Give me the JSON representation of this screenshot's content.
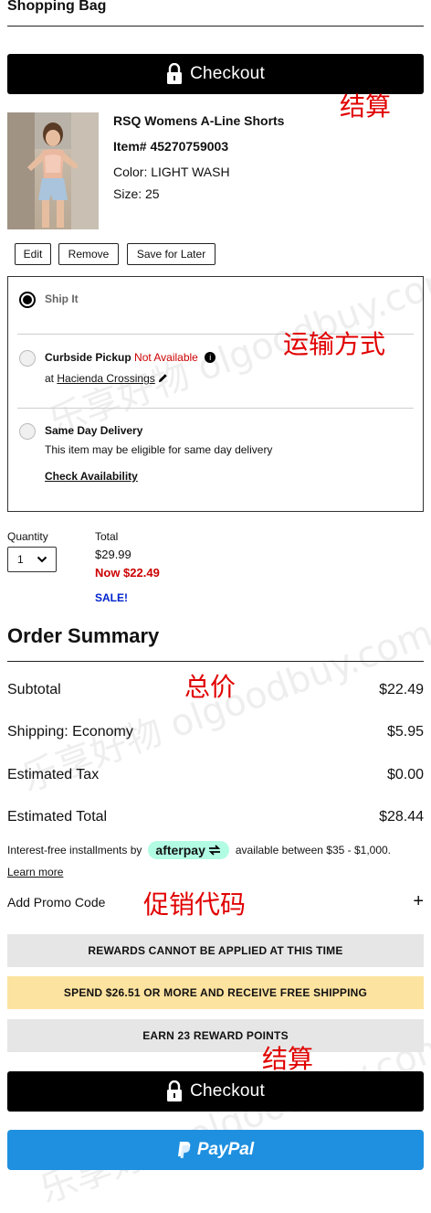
{
  "header": {
    "title": "Shopping Bag"
  },
  "checkout": {
    "label": "Checkout"
  },
  "annotations": {
    "checkout_top": "结算",
    "shipping": "运输方式",
    "total": "总价",
    "promo": "促销代码",
    "checkout_bottom": "结算"
  },
  "watermark": {
    "text": "乐享好物 olgoodbuy.com"
  },
  "product": {
    "name": "RSQ Womens A-Line Shorts",
    "item": "Item# 45270759003",
    "color": "Color: LIGHT WASH",
    "size": "Size: 25"
  },
  "actions": {
    "edit": "Edit",
    "remove": "Remove",
    "save": "Save for Later"
  },
  "shipping": {
    "ship_it": "Ship It",
    "curbside": "Curbside Pickup",
    "not_available": "Not Available",
    "at": "at",
    "store": "Hacienda Crossings",
    "same_day": "Same Day Delivery",
    "same_day_sub": "This item may be eligible for same day delivery",
    "check": "Check Availability",
    "selected": "Ship It"
  },
  "quantity": {
    "label": "Quantity",
    "value": "1"
  },
  "price": {
    "label": "Total",
    "orig": "$29.99",
    "now": "Now $22.49",
    "sale": "SALE!"
  },
  "summary": {
    "title": "Order Summary",
    "subtotal_label": "Subtotal",
    "subtotal": "$22.49",
    "shipping_label": "Shipping:",
    "shipping_method": "Economy",
    "shipping": "$5.95",
    "tax_label": "Estimated Tax",
    "tax": "$0.00",
    "total_label": "Estimated Total",
    "total": "$28.44"
  },
  "afterpay": {
    "prefix": "Interest-free installments by",
    "brand": "afterpay",
    "suffix": "available between $35 - $1,000.",
    "learn": "Learn more"
  },
  "promo": {
    "label": "Add Promo Code",
    "plus": "+"
  },
  "banners": {
    "rewards": "REWARDS CANNOT BE APPLIED AT THIS TIME",
    "free_ship": "SPEND $26.51 OR MORE AND RECEIVE FREE SHIPPING",
    "earn": "EARN 23 REWARD POINTS"
  },
  "paypal": {
    "label": "PayPal"
  },
  "colors": {
    "sale_red": "#cc0000",
    "sale_blue": "#0022cc",
    "annotation_red": "#e10000",
    "free_ship_bg": "#fde3a0",
    "banner_gray": "#e6e6e6",
    "afterpay_mint": "#b2fce4",
    "paypal_blue": "#1f90e0"
  }
}
